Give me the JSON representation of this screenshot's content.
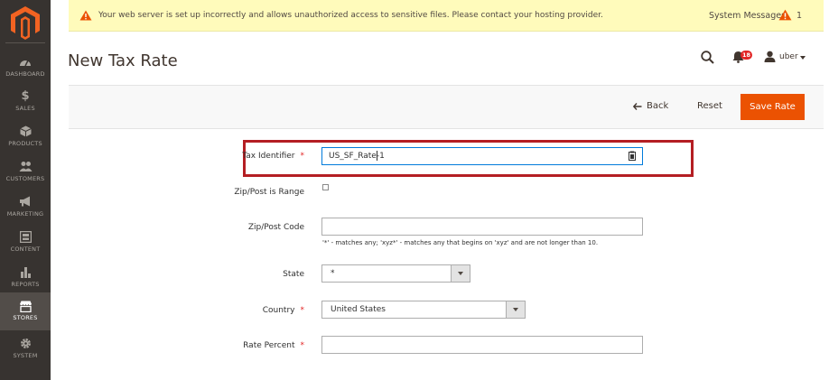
{
  "sidebar": {
    "items": [
      {
        "label": "DASHBOARD",
        "icon": "dashboard-icon"
      },
      {
        "label": "SALES",
        "icon": "dollar-icon"
      },
      {
        "label": "PRODUCTS",
        "icon": "cube-icon"
      },
      {
        "label": "CUSTOMERS",
        "icon": "customers-icon"
      },
      {
        "label": "MARKETING",
        "icon": "megaphone-icon"
      },
      {
        "label": "CONTENT",
        "icon": "content-icon"
      },
      {
        "label": "REPORTS",
        "icon": "bar-chart-icon"
      },
      {
        "label": "STORES",
        "icon": "store-icon",
        "active": true
      },
      {
        "label": "SYSTEM",
        "icon": "gear-icon"
      }
    ]
  },
  "system_message": {
    "text": "Your web server is set up incorrectly and allows unauthorized access to sensitive files. Please contact your hosting provider.",
    "label": "System Messages:",
    "count": "1"
  },
  "header": {
    "title": "New Tax Rate",
    "notifications_count": "18",
    "user_name": "uber"
  },
  "actions": {
    "back_label": "Back",
    "reset_label": "Reset",
    "save_label": "Save Rate"
  },
  "form": {
    "tax_identifier": {
      "label": "Tax Identifier",
      "required": "*",
      "value": "US_SF_Rate-1"
    },
    "zip_is_range": {
      "label": "Zip/Post is Range",
      "checked": false
    },
    "zip_code": {
      "label": "Zip/Post Code",
      "value": "",
      "note": "'*' - matches any; 'xyz*' - matches any that begins on 'xyz' and are not longer than 10."
    },
    "state": {
      "label": "State",
      "value": "*"
    },
    "country": {
      "label": "Country",
      "required": "*",
      "value": "United States"
    },
    "rate_percent": {
      "label": "Rate Percent",
      "required": "*",
      "value": ""
    }
  },
  "colors": {
    "accent": "#eb5202",
    "sidebar_bg": "#373330",
    "highlight": "#b41e23"
  }
}
